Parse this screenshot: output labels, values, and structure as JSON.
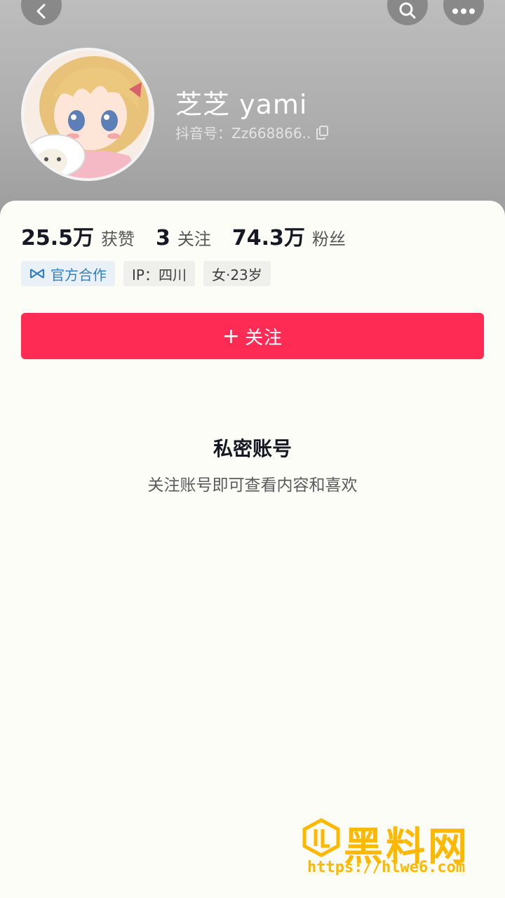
{
  "profile": {
    "display_name": "芝芝 yami",
    "handle": "抖音号：Zz668866.."
  },
  "stats": [
    {
      "value": "25.5万",
      "label": "获赞"
    },
    {
      "value": "3",
      "label": "关注"
    },
    {
      "value": "74.3万",
      "label": "粉丝"
    }
  ],
  "tags": {
    "official": "官方合作",
    "ip": "IP：四川",
    "gender_age": "女·23岁"
  },
  "follow_button": {
    "plus": "+",
    "label": "关注"
  },
  "private": {
    "title": "私密账号",
    "subtitle": "关注账号即可查看内容和喜欢"
  },
  "watermark": {
    "brand": "黑料网",
    "url": "https://hlwe6.com"
  },
  "colors": {
    "accent": "#fe2c55",
    "official_tag": "#2f7fc1",
    "watermark": "#ffb800"
  },
  "icons": [
    "back-icon",
    "search-icon",
    "more-icon",
    "copy-icon",
    "official-partner-icon",
    "avatar-image",
    "watermark-logo-icon"
  ]
}
